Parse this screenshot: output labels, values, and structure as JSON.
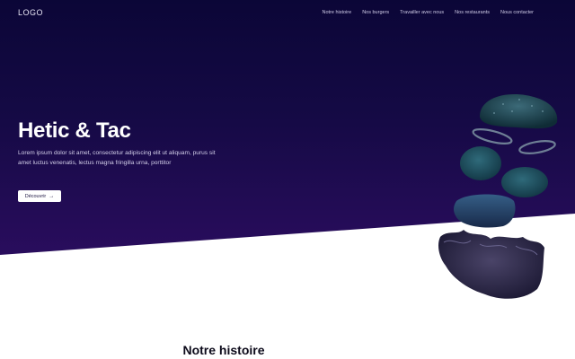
{
  "header": {
    "logo": "LOGO",
    "nav": [
      {
        "label": "Notre histoire"
      },
      {
        "label": "Nos burgers"
      },
      {
        "label": "Travailler avec nous"
      },
      {
        "label": "Nos restaurants"
      },
      {
        "label": "Nous contacter"
      }
    ]
  },
  "hero": {
    "title": "Hetic & Tac",
    "description": "Lorem ipsum dolor sit amet, consectetur adipiscing elit ut aliquam, purus sit amet luctus venenatis, lectus magna fringilla urna, porttitor",
    "cta_label": "Découvrir",
    "cta_icon": "arrow-right-icon"
  },
  "sections": {
    "story_title": "Notre histoire"
  },
  "colors": {
    "hero_top": "#0b0637",
    "hero_bottom": "#2a0d5e",
    "text_light": "#ffffff"
  }
}
